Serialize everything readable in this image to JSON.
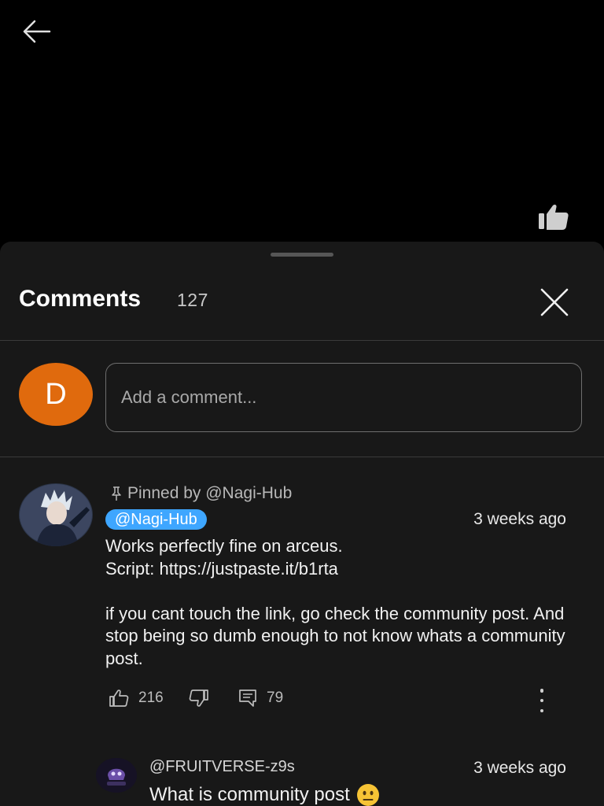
{
  "sheet": {
    "title": "Comments",
    "count": "127",
    "user_avatar_letter": "D",
    "input_placeholder": "Add a comment..."
  },
  "pinned_comment": {
    "pinned_label": "Pinned by @Nagi-Hub",
    "author": "@Nagi-Hub",
    "timestamp": "3 weeks ago",
    "text": "Works perfectly fine on arceus.\nScript: https://justpaste.it/b1rta\n\nif you cant touch the link, go check the community post. And stop being so dumb enough to not know whats a community post.",
    "likes": "216",
    "replies": "79"
  },
  "reply": {
    "author": "@FRUITVERSE-z9s",
    "timestamp": "3 weeks ago",
    "text": "What is community post",
    "emoji": "neutral-face"
  },
  "colors": {
    "background": "#000000",
    "sheet": "#181818",
    "avatar_orange": "#e06a0d",
    "author_chip": "#3ea6ff"
  }
}
